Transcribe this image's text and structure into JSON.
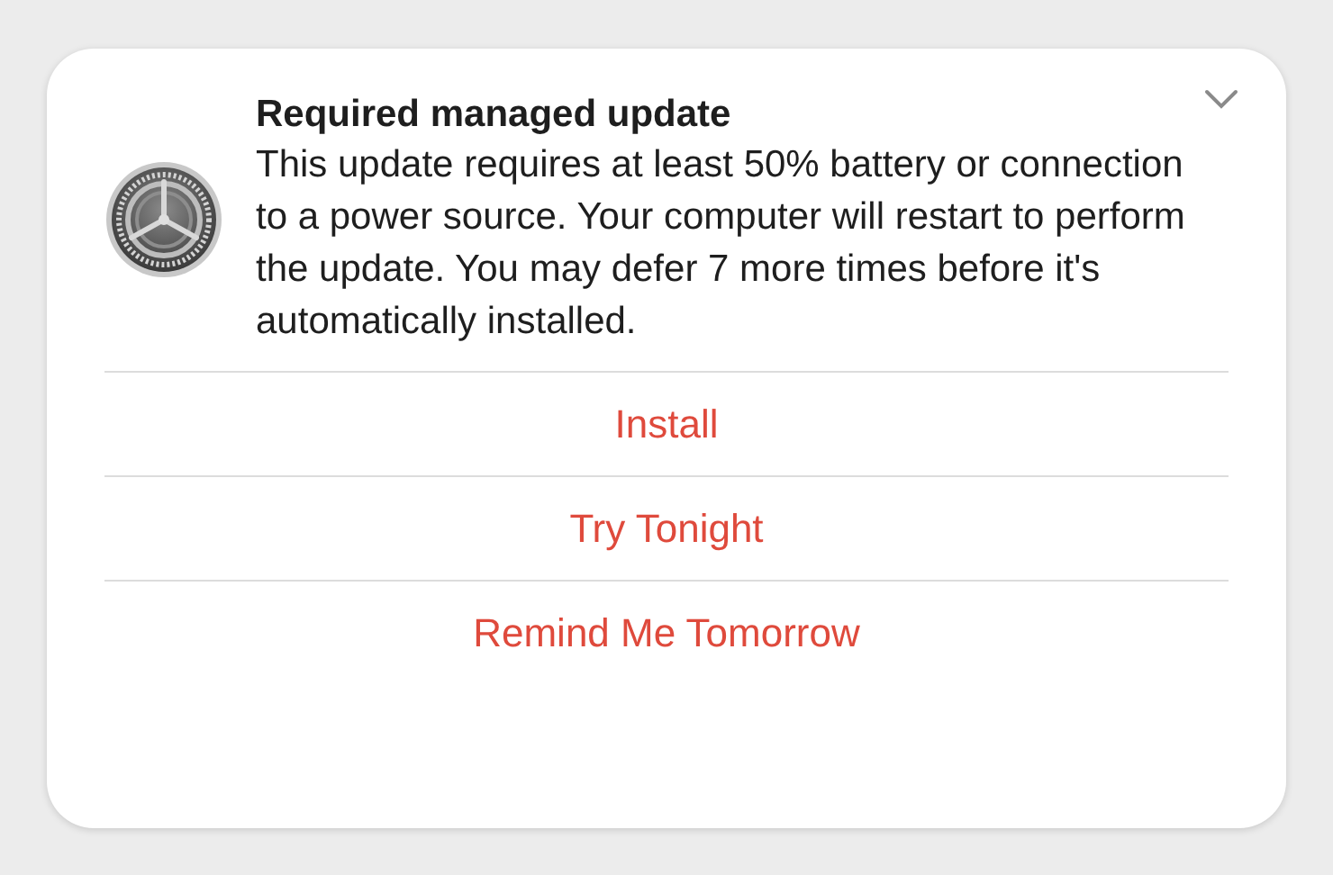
{
  "notification": {
    "title": "Required managed update",
    "body": "This update requires at least 50% battery or connection to a power source. Your computer will restart to perform the update. You may defer 7 more times before it's automatically installed.",
    "expanded": false,
    "actions": [
      {
        "label": "Install"
      },
      {
        "label": "Try Tonight"
      },
      {
        "label": "Remind Me Tomorrow"
      }
    ]
  }
}
